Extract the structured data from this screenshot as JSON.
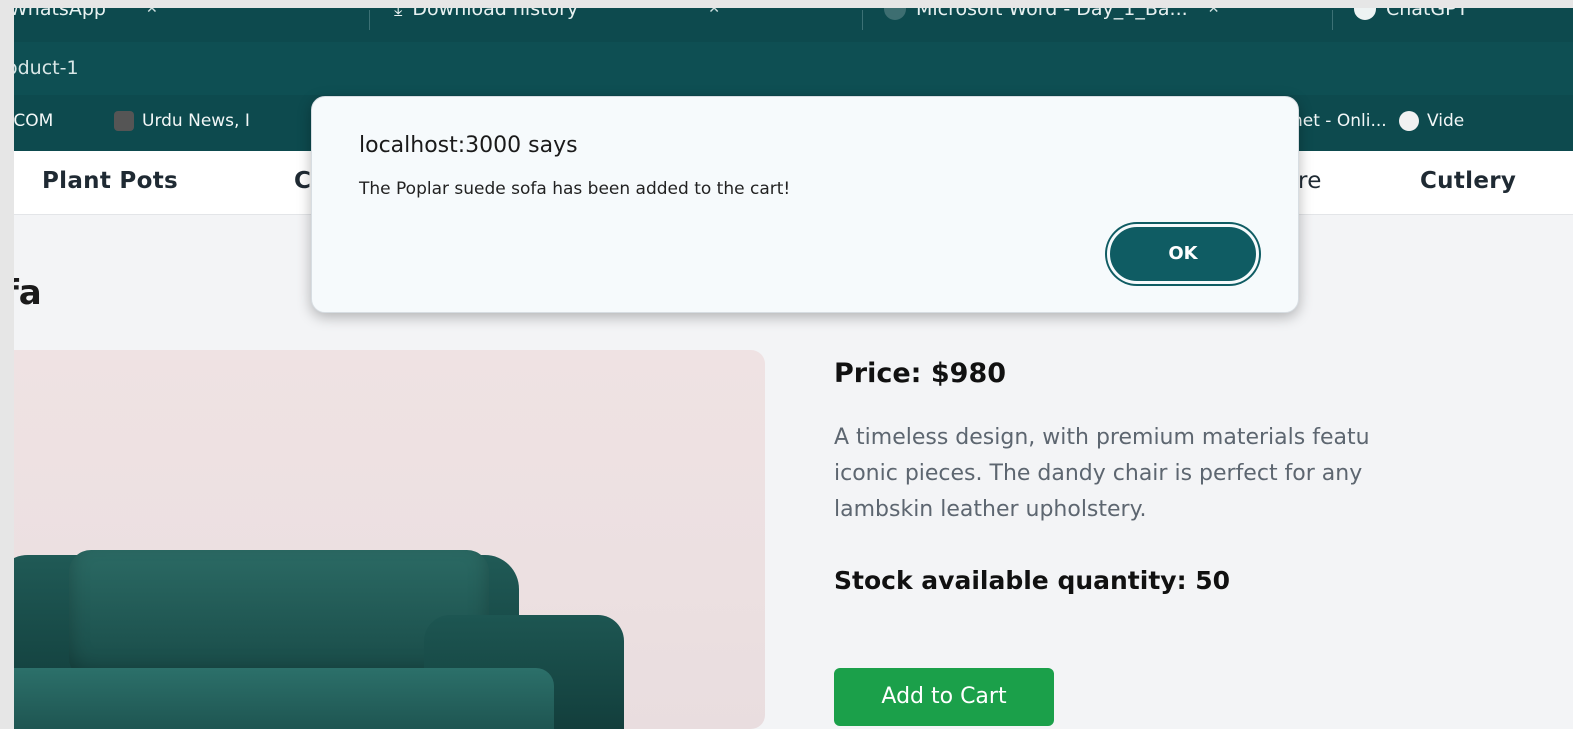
{
  "browser": {
    "tabs": [
      {
        "label": "WhatsApp",
        "icon": "whatsapp-icon"
      },
      {
        "label": "Download history",
        "icon": "download-icon"
      },
      {
        "label": "Microsoft Word - Day_1_Ba...",
        "icon": "word-icon"
      },
      {
        "label": "ChatGPT",
        "icon": "chatgpt-icon"
      }
    ],
    "address": "oduct-1",
    "bookmarks": [
      {
        "label": ".COM",
        "icon": ""
      },
      {
        "label": "Urdu News, I",
        "icon": "urdu-news-icon"
      },
      {
        "label": "net - Onli...",
        "icon": ""
      },
      {
        "label": "Vide",
        "icon": "video-icon"
      }
    ]
  },
  "nav": {
    "items": [
      "Plant Pots",
      "C",
      "re",
      "Cutlery"
    ]
  },
  "product": {
    "title": "fa",
    "price": "Price: $980",
    "description": "A timeless design, with premium materials featu\niconic pieces. The dandy chair is perfect for any\nlambskin leather upholstery.",
    "stock": "Stock available quantity: 50",
    "add_to_cart_label": "Add to Cart"
  },
  "dialog": {
    "title": "localhost:3000 says",
    "message": "The Poplar suede sofa has been added to the cart!",
    "ok_label": "OK"
  },
  "colors": {
    "chrome": "#0d4a4e",
    "accent_button": "#1ba04a",
    "dialog_ok": "#0f5c63"
  }
}
